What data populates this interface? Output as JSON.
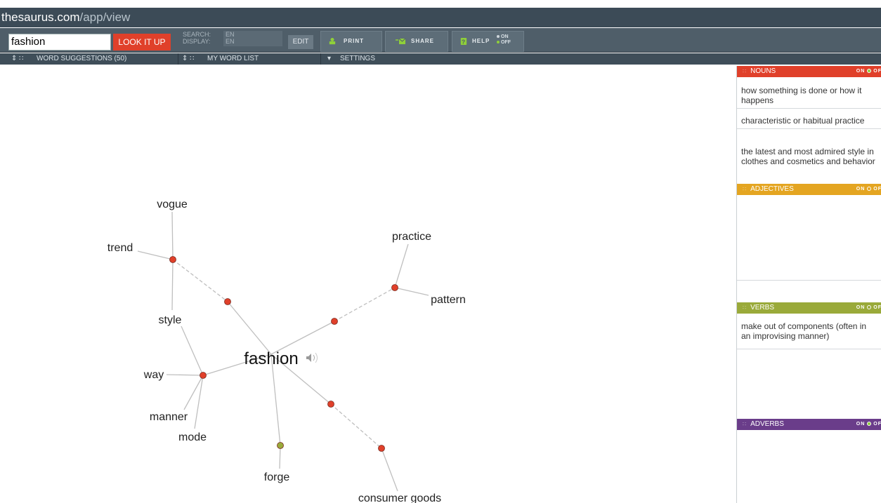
{
  "url": {
    "host": "thesaurus.com",
    "path": "/app/view"
  },
  "toolbar": {
    "search_value": "fashion",
    "lookup_label": "LOOK IT UP",
    "search_label": "SEARCH:",
    "display_label": "DISPLAY:",
    "search_lang": "EN",
    "display_lang": "EN",
    "edit_label": "EDIT",
    "print_label": "PRINT",
    "share_label": "SHARE",
    "help_label": "HELP",
    "help_on": "ON",
    "help_off": "OFF"
  },
  "subbar": {
    "suggestions": "WORD SUGGESTIONS (50)",
    "wordlist": "MY WORD LIST",
    "settings": "SETTINGS"
  },
  "graph": {
    "center": "fashion",
    "words": {
      "vogue": "vogue",
      "trend": "trend",
      "style": "style",
      "way": "way",
      "manner": "manner",
      "mode": "mode",
      "forge": "forge",
      "consumer_goods": "consumer goods",
      "practice": "practice",
      "pattern": "pattern"
    },
    "colors": {
      "noun": "#e0402a",
      "verb": "#9aaa3a",
      "line": "#bfbfbf"
    }
  },
  "panel": {
    "nouns": {
      "label": "NOUNS",
      "color": "#e0402a",
      "on": "ON",
      "off": "OF",
      "definitions": [
        "how something is done or how it happens",
        "characteristic or habitual practice",
        "the latest and most admired style in clothes and cosmetics and behavior"
      ]
    },
    "adjectives": {
      "label": "ADJECTIVES",
      "color": "#e4a521",
      "on": "ON",
      "off": "OF"
    },
    "verbs": {
      "label": "VERBS",
      "color": "#9aaa3a",
      "on": "ON",
      "off": "OF",
      "definitions": [
        "make out of components (often in an improvising manner)"
      ]
    },
    "adverbs": {
      "label": "ADVERBS",
      "color": "#6a3d8a",
      "on": "ON",
      "off": "OF"
    }
  }
}
